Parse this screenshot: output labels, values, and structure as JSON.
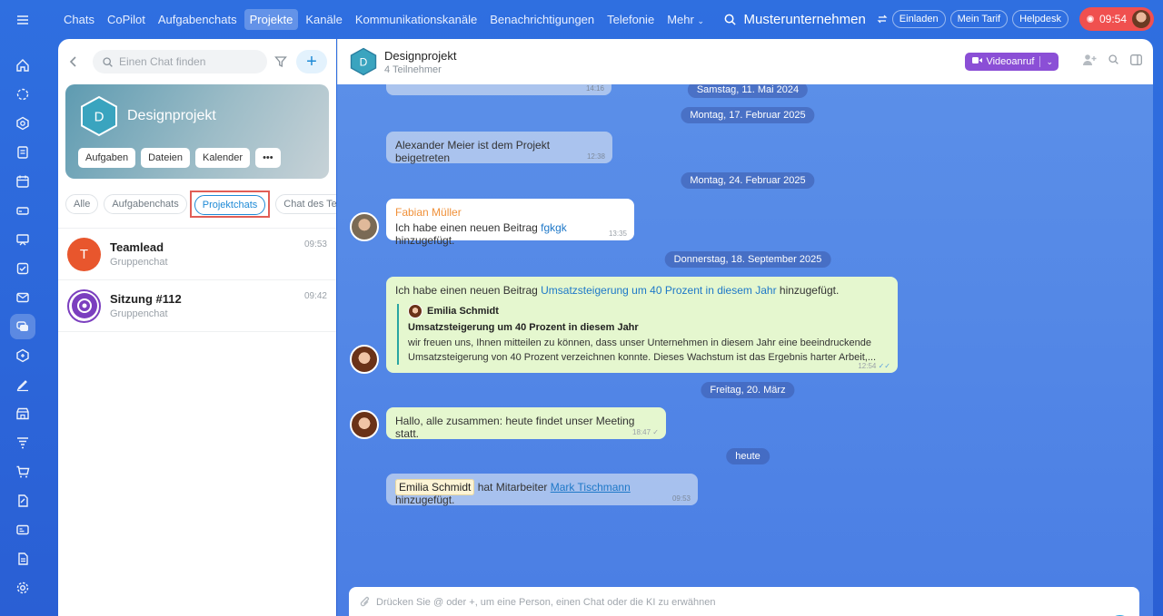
{
  "rail": {
    "items": [
      {
        "icon": "menu-icon"
      },
      {
        "icon": "home-icon"
      },
      {
        "icon": "copilot-icon"
      },
      {
        "icon": "circle-icon"
      },
      {
        "icon": "tasks-icon"
      },
      {
        "icon": "calendar-icon"
      },
      {
        "icon": "drive-icon"
      },
      {
        "icon": "board-icon"
      },
      {
        "icon": "check-icon"
      },
      {
        "icon": "mail-icon"
      },
      {
        "icon": "chat-icon"
      },
      {
        "icon": "crm-icon"
      },
      {
        "icon": "sign-icon"
      },
      {
        "icon": "store-icon"
      },
      {
        "icon": "filter-icon"
      },
      {
        "icon": "cart-icon"
      },
      {
        "icon": "edit-doc-icon"
      },
      {
        "icon": "card-icon"
      },
      {
        "icon": "document-icon"
      },
      {
        "icon": "settings-icon"
      }
    ]
  },
  "topnav": {
    "items": [
      "Chats",
      "CoPilot",
      "Aufgabenchats",
      "Projekte",
      "Kanäle",
      "Kommunikationskanäle",
      "Benachrichtigungen",
      "Telefonie",
      "Mehr"
    ],
    "active_index": 3,
    "org_name": "Musterunternehmen",
    "invite": "Einladen",
    "plan": "Mein Tarif",
    "helpdesk": "Helpdesk",
    "timer": "09:54"
  },
  "sidebar": {
    "search_placeholder": "Einen Chat finden",
    "project": {
      "initial": "D",
      "title": "Designprojekt",
      "actions": [
        "Aufgaben",
        "Dateien",
        "Kalender",
        "•••"
      ]
    },
    "filters": [
      "Alle",
      "Aufgabenchats",
      "Projektchats",
      "Chat des Te"
    ],
    "active_filter": "Projektchats",
    "chats": [
      {
        "initial": "T",
        "name": "Teamlead",
        "sub": "Gruppenchat",
        "time": "09:53",
        "color": "#e8562d"
      },
      {
        "initial": "",
        "name": "Sitzung #112",
        "sub": "Gruppenchat",
        "time": "09:42",
        "color": "#7b3fbf"
      }
    ]
  },
  "chat": {
    "initial": "D",
    "title": "Designprojekt",
    "subtitle": "4 Teilnehmer",
    "video_label": "Videoanruf",
    "dates": {
      "d1": "Samstag, 11. Mai 2024",
      "d2": "Montag, 17. Februar 2025",
      "d3": "Montag, 24. Februar 2025",
      "d4": "Donnerstag, 18. September 2025",
      "d5": "Freitag, 20. März",
      "d6": "heute"
    },
    "top_time": "14:16",
    "messages": {
      "m1": {
        "text": "Alexander Meier ist dem Projekt beigetreten",
        "time": "12:38"
      },
      "m2": {
        "author": "Fabian Müller",
        "prefix": "Ich habe einen neuen Beitrag ",
        "link": "fgkgk",
        "suffix": " hinzugefügt.",
        "time": "13:35"
      },
      "m3": {
        "prefix": "Ich habe einen neuen Beitrag ",
        "link": "Umsatzsteigerung um 40 Prozent in diesem Jahr",
        "suffix": " hinzugefügt.",
        "quote_author": "Emilia Schmidt",
        "quote_title": "Umsatzsteigerung um 40 Prozent in diesem Jahr",
        "quote_line1": "wir freuen uns, Ihnen mitteilen zu können, dass unser Unternehmen in diesem Jahr eine beeindruckende",
        "quote_line2": "Umsatzsteigerung von 40 Prozent verzeichnen konnte. Dieses Wachstum ist das Ergebnis harter Arbeit,...",
        "time": "12:54"
      },
      "m4": {
        "text": "Hallo, alle zusammen: heute findet unser Meeting statt.",
        "time": "18:47"
      },
      "m5": {
        "mention": "Emilia Schmidt",
        "middle": " hat Mitarbeiter ",
        "link": "Mark Tischmann",
        "suffix": " hinzugefügt.",
        "time": "09:53"
      }
    },
    "composer_placeholder": "Drücken Sie @ oder +, um eine Person, einen Chat oder die KI zu erwähnen"
  },
  "colors": {
    "accent": "#1e8ad6",
    "video": "#8b4fd6",
    "timer": "#f0504f",
    "highlight_box": "#e15e56",
    "hex_badge": "#3aa4bf"
  }
}
